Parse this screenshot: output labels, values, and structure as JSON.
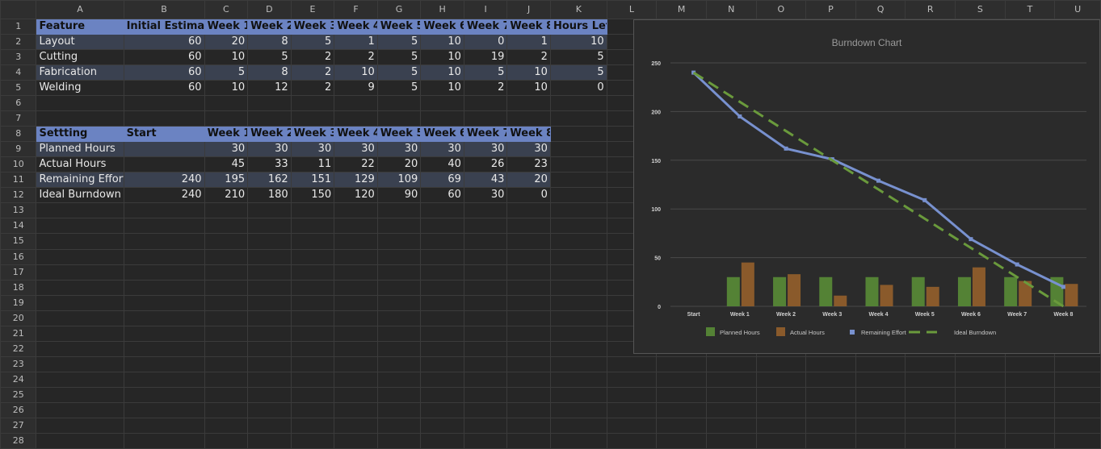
{
  "columns": [
    "A",
    "B",
    "C",
    "D",
    "E",
    "F",
    "G",
    "H",
    "I",
    "J",
    "K",
    "L",
    "M",
    "N",
    "O",
    "P",
    "Q",
    "R",
    "S",
    "T",
    "U"
  ],
  "rows": [
    "1",
    "2",
    "3",
    "4",
    "5",
    "6",
    "7",
    "8",
    "9",
    "10",
    "11",
    "12",
    "13",
    "14",
    "15",
    "16",
    "17",
    "18",
    "19",
    "20",
    "21",
    "22",
    "23",
    "24",
    "25",
    "26",
    "27",
    "28"
  ],
  "table1": {
    "headers": [
      "Feature",
      "Initial Estimate",
      "Week 1",
      "Week 2",
      "Week 3",
      "Week 4",
      "Week 5",
      "Week 6",
      "Week 7",
      "Week 8",
      "Hours Left"
    ],
    "rows": [
      [
        "Layout",
        "60",
        "20",
        "8",
        "5",
        "1",
        "5",
        "10",
        "0",
        "1",
        "10"
      ],
      [
        "Cutting",
        "60",
        "10",
        "5",
        "2",
        "2",
        "5",
        "10",
        "19",
        "2",
        "5"
      ],
      [
        "Fabrication",
        "60",
        "5",
        "8",
        "2",
        "10",
        "5",
        "10",
        "5",
        "10",
        "5"
      ],
      [
        "Welding",
        "60",
        "10",
        "12",
        "2",
        "9",
        "5",
        "10",
        "2",
        "10",
        "0"
      ]
    ]
  },
  "table2": {
    "headers": [
      "Settting",
      "Start",
      "Week 1",
      "Week 2",
      "Week 3",
      "Week 4",
      "Week 5",
      "Week 6",
      "Week 7",
      "Week 8"
    ],
    "rows": [
      [
        "Planned Hours",
        "",
        "30",
        "30",
        "30",
        "30",
        "30",
        "30",
        "30",
        "30"
      ],
      [
        "Actual Hours",
        "",
        "45",
        "33",
        "11",
        "22",
        "20",
        "40",
        "26",
        "23"
      ],
      [
        "Remaining Effort",
        "240",
        "195",
        "162",
        "151",
        "129",
        "109",
        "69",
        "43",
        "20"
      ],
      [
        "Ideal Burndown",
        "240",
        "210",
        "180",
        "150",
        "120",
        "90",
        "60",
        "30",
        "0"
      ]
    ]
  },
  "chart_data": {
    "type": "bar",
    "title": "Burndown Chart",
    "categories": [
      "Start",
      "Week 1",
      "Week 2",
      "Week 3",
      "Week 4",
      "Week 5",
      "Week 6",
      "Week 7",
      "Week 8"
    ],
    "ylim": [
      0,
      250
    ],
    "yticks": [
      0,
      50,
      100,
      150,
      200,
      250
    ],
    "grid": true,
    "legend": "bottom",
    "series": [
      {
        "name": "Planned Hours",
        "type": "bar",
        "color": "#548235",
        "values": [
          null,
          30,
          30,
          30,
          30,
          30,
          30,
          30,
          30
        ]
      },
      {
        "name": "Actual Hours",
        "type": "bar",
        "color": "#8a5a2b",
        "values": [
          null,
          45,
          33,
          11,
          22,
          20,
          40,
          26,
          23
        ]
      },
      {
        "name": "Remaining Effort",
        "type": "line",
        "color": "#7891cf",
        "values": [
          240,
          195,
          162,
          151,
          129,
          109,
          69,
          43,
          20
        ]
      },
      {
        "name": "Ideal Burndown",
        "type": "dashed-line",
        "color": "#6a9a3c",
        "values": [
          240,
          210,
          180,
          150,
          120,
          90,
          60,
          30,
          0
        ]
      }
    ]
  }
}
